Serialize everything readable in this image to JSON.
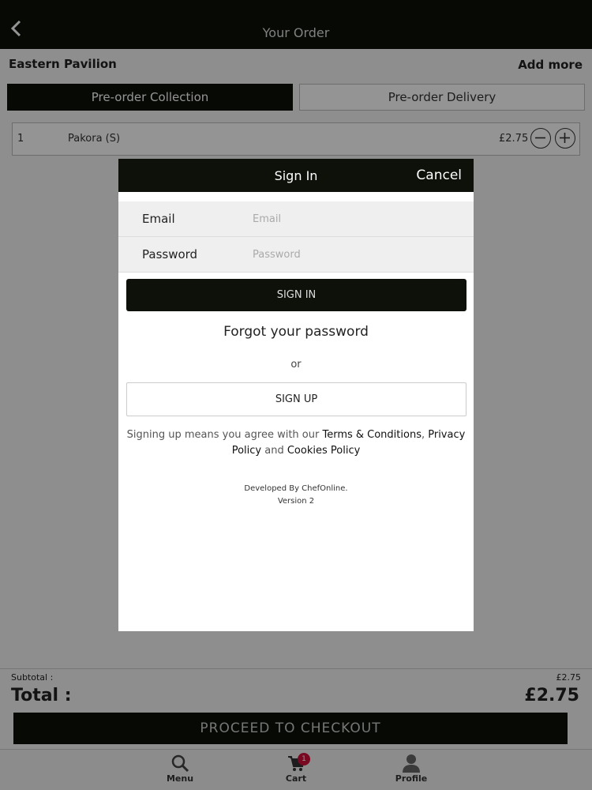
{
  "header": {
    "title": "Your Order",
    "back_icon": "chevron-left-icon"
  },
  "restaurant": {
    "name": "Eastern Pavilion",
    "add_more_label": "Add more"
  },
  "order_type_tabs": [
    {
      "label": "Pre-order Collection",
      "selected": true
    },
    {
      "label": "Pre-order Delivery",
      "selected": false
    }
  ],
  "order_items": [
    {
      "qty": "1",
      "name": "Pakora (S)",
      "price": "£2.75"
    }
  ],
  "summary": {
    "subtotal_label": "Subtotal :",
    "subtotal_value": "£2.75",
    "total_label": "Total :",
    "total_value": "£2.75"
  },
  "checkout_label": "PROCEED TO CHECKOUT",
  "tabbar": {
    "menu_label": "Menu",
    "cart_label": "Cart",
    "cart_badge": "1",
    "profile_label": "Profile"
  },
  "signin_modal": {
    "title": "Sign In",
    "cancel_label": "Cancel",
    "email_label": "Email",
    "email_placeholder": "Email",
    "email_value": "",
    "password_label": "Password",
    "password_placeholder": "Password",
    "password_value": "",
    "signin_label": "SIGN IN",
    "forgot_label": "Forgot your password",
    "or_label": "or",
    "signup_label": "SIGN UP",
    "terms_prefix": "Signing up means you agree with our ",
    "terms_link": "Terms & Conditions",
    "terms_sep": ", ",
    "privacy_link": "Privacy Policy",
    "terms_and": " and ",
    "cookies_link": "Cookies Policy",
    "developed_by": "Developed By ChefOnline.",
    "version": "Version 2"
  },
  "colors": {
    "dark": "#0d1109",
    "badge": "#d0103a"
  }
}
